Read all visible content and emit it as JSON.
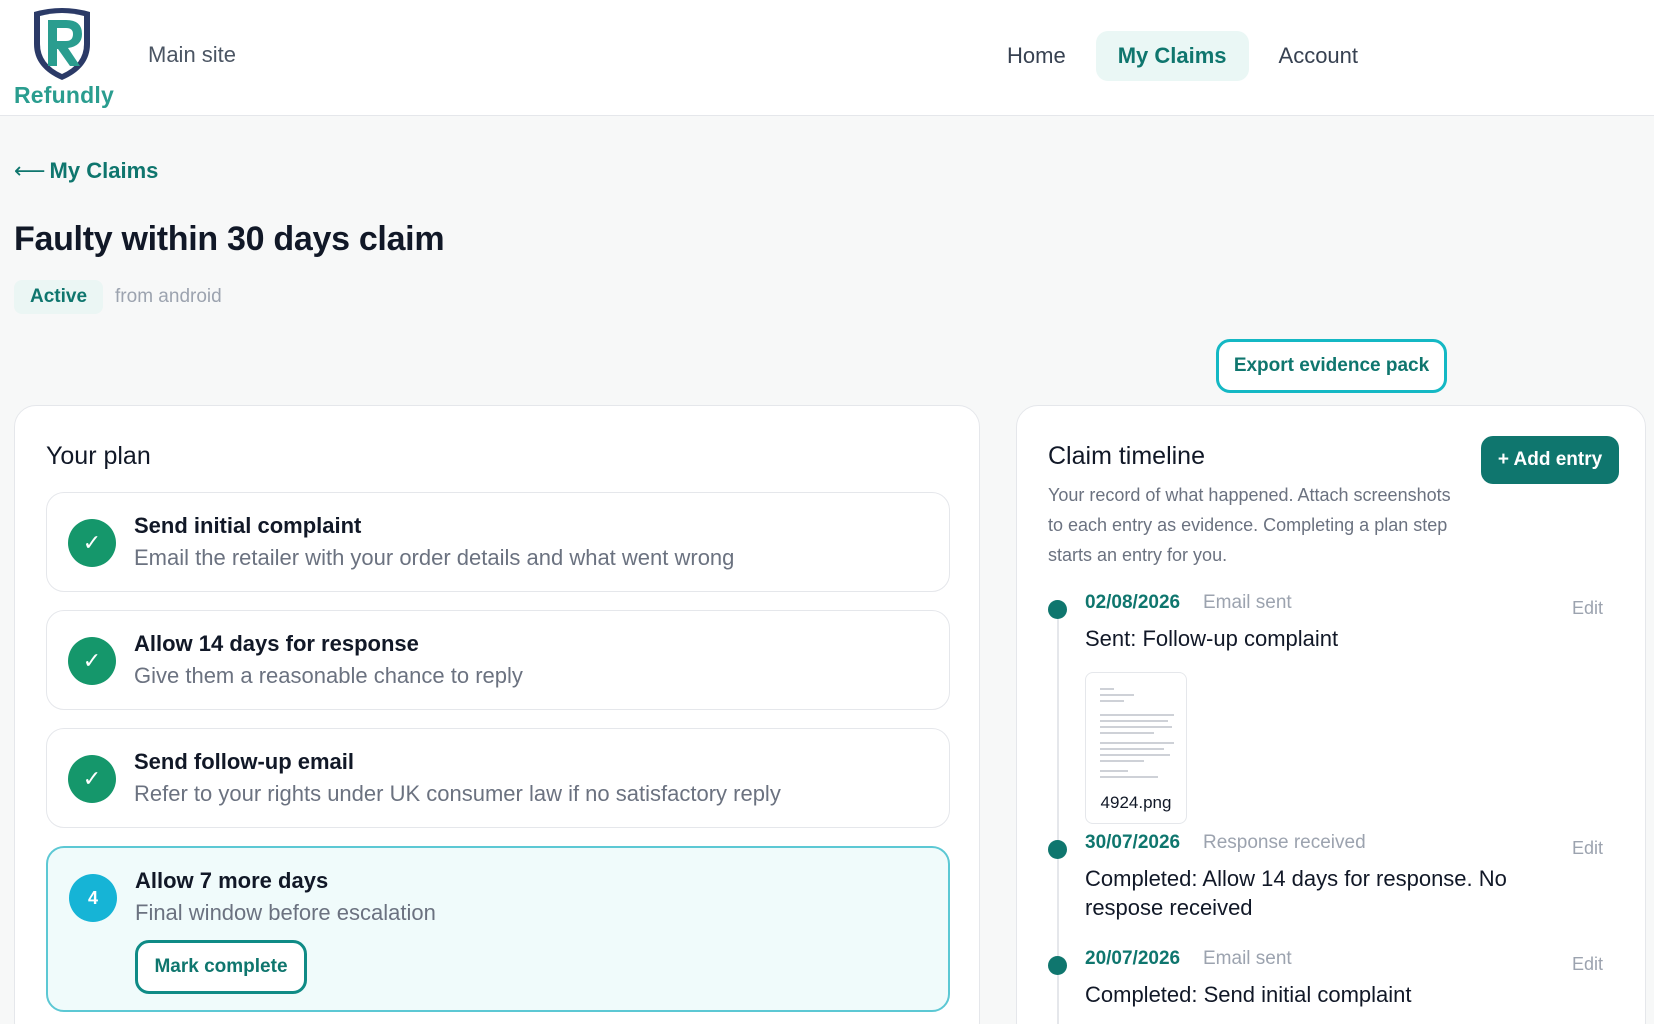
{
  "colors": {
    "brand": "#0f766e",
    "brand_light": "#2a9d8f",
    "complete_green": "#15976b",
    "current_cyan": "#16b4d6",
    "current_border": "#5cc8d4"
  },
  "header": {
    "logo_text": "Refundly",
    "main_site_label": "Main site",
    "nav": [
      {
        "label": "Home",
        "active": false
      },
      {
        "label": "My Claims",
        "active": true
      },
      {
        "label": "Account",
        "active": false
      }
    ]
  },
  "page": {
    "back_label": "My Claims",
    "title": "Faulty within 30 days claim",
    "status": "Active",
    "source": "from android",
    "export_label": "Export evidence pack"
  },
  "plan": {
    "title": "Your plan",
    "steps": [
      {
        "title": "Send initial complaint",
        "description": "Email the retailer with your order details and what went wrong",
        "state": "complete",
        "icon": "check-icon"
      },
      {
        "title": "Allow 14 days for response",
        "description": "Give them a reasonable chance to reply",
        "state": "complete",
        "icon": "check-icon"
      },
      {
        "title": "Send follow-up email",
        "description": "Refer to your rights under UK consumer law if no satisfactory reply",
        "state": "complete",
        "icon": "check-icon"
      },
      {
        "title": "Allow 7 more days",
        "description": "Final window before escalation",
        "state": "current",
        "number": "4",
        "action_label": "Mark complete"
      }
    ]
  },
  "timeline": {
    "title": "Claim timeline",
    "add_label": "+ Add entry",
    "description": "Your record of what happened. Attach screenshots to each entry as evidence. Completing a plan step starts an entry for you.",
    "entries": [
      {
        "date": "02/08/2026",
        "type": "Email sent",
        "text": "Sent: Follow-up complaint",
        "edit_label": "Edit",
        "attachment": "4924.png"
      },
      {
        "date": "30/07/2026",
        "type": "Response received",
        "text": "Completed: Allow 14 days for response. No respose received",
        "edit_label": "Edit"
      },
      {
        "date": "20/07/2026",
        "type": "Email sent",
        "text": "Completed: Send initial complaint",
        "edit_label": "Edit"
      }
    ]
  }
}
